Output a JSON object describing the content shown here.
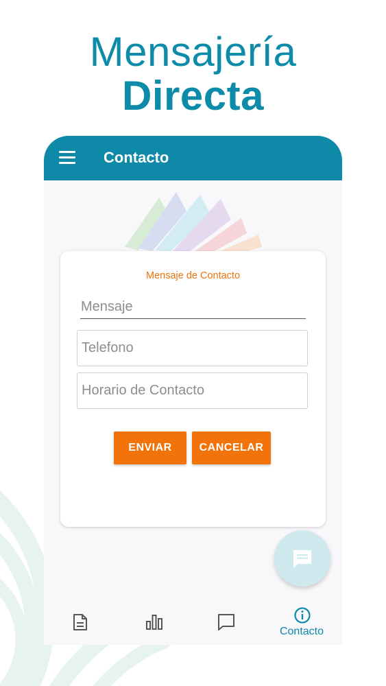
{
  "headline": {
    "line1": "Mensajería",
    "line2": "Directa"
  },
  "appbar": {
    "title": "Contacto"
  },
  "form": {
    "title": "Mensaje de Contacto",
    "mensaje_placeholder": "Mensaje",
    "telefono_placeholder": "Telefono",
    "horario_placeholder": "Horario de Contacto",
    "send_label": "ENVIAR",
    "cancel_label": "CANCELAR"
  },
  "bottom_nav": {
    "items": [
      {
        "icon": "document-icon"
      },
      {
        "icon": "bar-chart-icon"
      },
      {
        "icon": "chat-icon"
      },
      {
        "icon": "info-icon",
        "label": "Contacto",
        "active": true
      }
    ]
  },
  "colors": {
    "primary": "#0e8aa8",
    "accent": "#f2730a",
    "card_title": "#e8730c",
    "fab": "#cfe9ef"
  }
}
